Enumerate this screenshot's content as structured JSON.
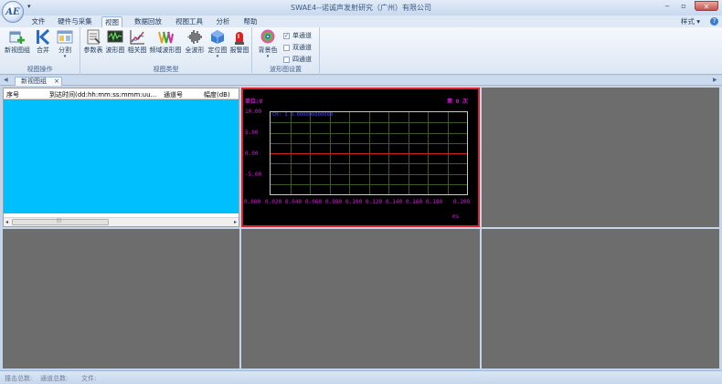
{
  "window": {
    "title": "SWAE4--诺诚声发射研究（广州）有限公司",
    "logo_text": "AE"
  },
  "menu": {
    "tabs": [
      "文件",
      "硬件与采集",
      "视图",
      "数据回放",
      "视图工具",
      "分析",
      "帮助"
    ],
    "active_tab": "视图",
    "style_label": "样式",
    "help_icon": "?"
  },
  "ribbon": {
    "groups": [
      {
        "label": "视图操作",
        "buttons": [
          {
            "label": "新视图组",
            "icon": "new-view-group-icon"
          },
          {
            "label": "合并",
            "icon": "merge-icon"
          },
          {
            "label": "分割",
            "icon": "split-icon"
          }
        ]
      },
      {
        "label": "视图类型",
        "buttons": [
          {
            "label": "参数表",
            "icon": "parameter-table-icon"
          },
          {
            "label": "波形图",
            "icon": "waveform-icon"
          },
          {
            "label": "相关图",
            "icon": "correlation-icon"
          },
          {
            "label": "频域波形图",
            "icon": "frequency-domain-icon"
          },
          {
            "label": "全波形",
            "icon": "full-waveform-icon"
          },
          {
            "label": "定位图",
            "icon": "location-icon"
          },
          {
            "label": "报警图",
            "icon": "alarm-icon"
          }
        ]
      },
      {
        "label": "波形图设置",
        "buttons": [
          {
            "label": "背景色",
            "icon": "background-color-icon"
          }
        ],
        "channel_options": [
          {
            "label": "单通道",
            "checked": true
          },
          {
            "label": "双通道",
            "checked": false
          },
          {
            "label": "四通道",
            "checked": false
          }
        ]
      }
    ]
  },
  "doc_tab": {
    "label": "新视图组",
    "close": "×"
  },
  "table": {
    "columns": [
      "序号",
      "到达时间(dd:hh:mm:ss:mmm:uu...",
      "通道号",
      "幅度(dB)"
    ],
    "rows": []
  },
  "waveform": {
    "unit_label": "单位:V",
    "count_label": "第 0 次",
    "channel_label": "CH: 1   0.000000000000",
    "x_unit": "ms",
    "y_ticks": [
      "10.00",
      "5.00",
      "0.00",
      "-5.00"
    ],
    "x_ticks": [
      "0.000",
      "0.020",
      "0.040",
      "0.060",
      "0.080",
      "0.100",
      "0.120",
      "0.140",
      "0.160",
      "0.180",
      "0.200"
    ]
  },
  "status": {
    "hits_total": "撞击总数:",
    "channels_total": "通道总数:",
    "file": "文件:"
  }
}
